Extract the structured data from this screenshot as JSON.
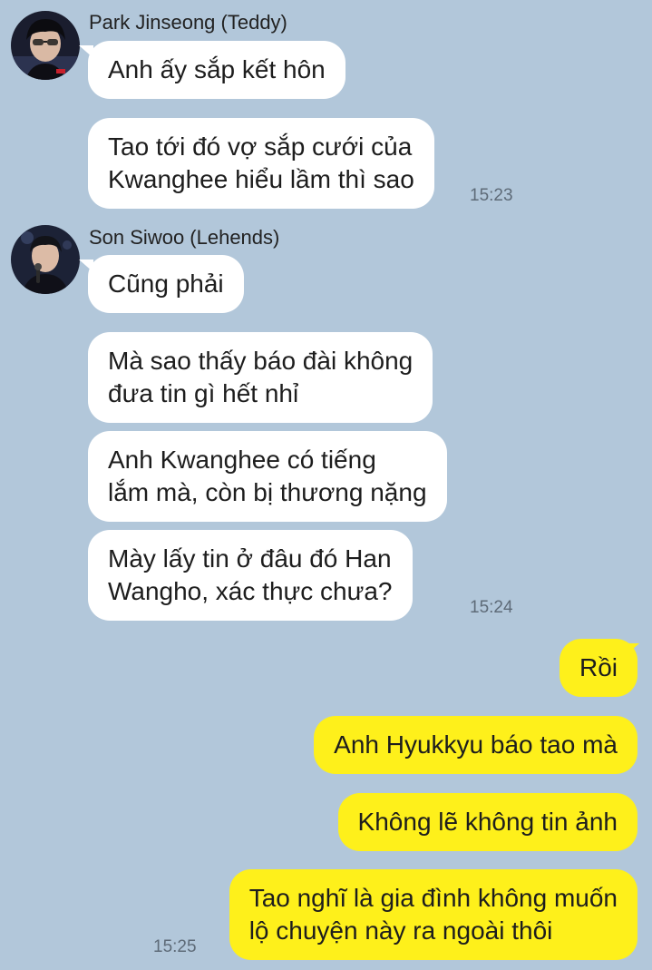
{
  "app": {
    "background_color": "#b2c7da",
    "incoming_bubble_color": "#ffffff",
    "outgoing_bubble_color": "#fef01b"
  },
  "groups": [
    {
      "sender": "Park Jinseong (Teddy)",
      "avatar_icon": "profile-photo",
      "messages": [
        "Anh ấy sắp kết hôn",
        "Tao tới đó vợ sắp cưới của\nKwanghee hiểu lầm thì sao"
      ],
      "time": "15:23"
    },
    {
      "sender": "Son Siwoo (Lehends)",
      "avatar_icon": "profile-photo",
      "messages": [
        "Cũng phải",
        "Mà sao thấy báo đài không\nđưa tin gì hết nhỉ",
        "Anh Kwanghee có tiếng\nlắm mà, còn bị thương nặng",
        "Mày lấy tin ở đâu đó Han\nWangho, xác thực chưa?"
      ],
      "time": "15:24"
    }
  ],
  "outgoing": {
    "messages": [
      "Rồi",
      "Anh Hyukkyu báo tao mà",
      "Không lẽ không tin ảnh",
      "Tao nghĩ là gia đình không muốn\nlộ chuyện này ra ngoài thôi"
    ],
    "time": "15:25"
  }
}
